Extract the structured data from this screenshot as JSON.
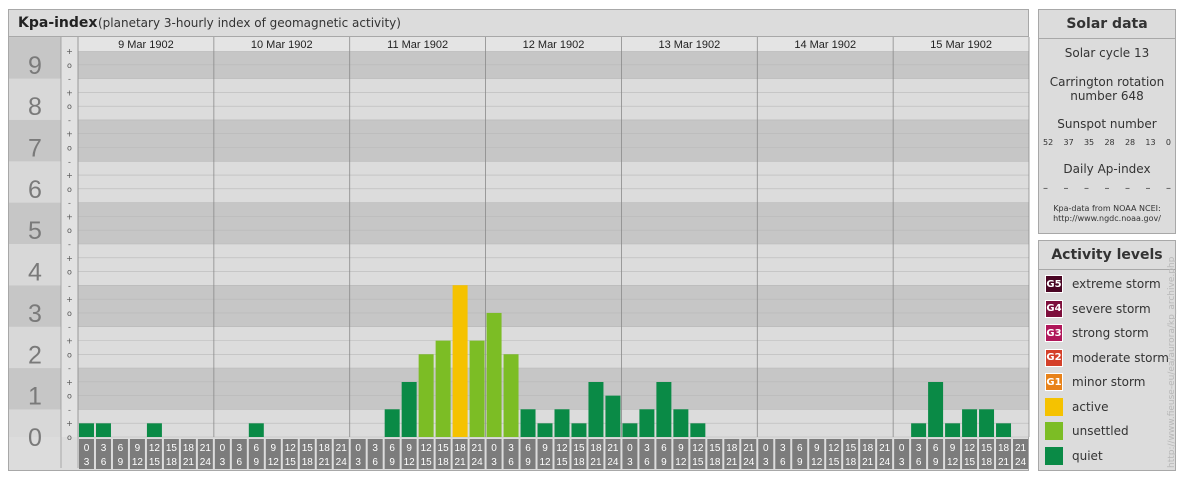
{
  "title": "Kpa-index",
  "subtitle": "(planetary 3-hourly index of geomagnetic activity)",
  "chart_data": {
    "type": "bar",
    "days": [
      "9 Mar 1902",
      "10 Mar 1902",
      "11 Mar 1902",
      "12 Mar 1902",
      "13 Mar 1902",
      "14 Mar 1902",
      "15 Mar 1902"
    ],
    "interval_start_labels": [
      "0",
      "3",
      "6",
      "9",
      "12",
      "15",
      "18",
      "21"
    ],
    "interval_end_labels": [
      "3",
      "6",
      "9",
      "12",
      "15",
      "18",
      "21",
      "24"
    ],
    "y_major_labels": [
      "0",
      "1",
      "2",
      "3",
      "4",
      "5",
      "6",
      "7",
      "8",
      "9"
    ],
    "y_minor_labels": [
      "-",
      "o",
      "+"
    ],
    "ylim": [
      0,
      9.33
    ],
    "values": [
      0.33,
      0.33,
      0,
      0,
      0.33,
      0,
      0,
      0,
      0,
      0,
      0.33,
      0,
      0,
      0,
      0,
      0,
      0,
      0,
      0.67,
      1.33,
      2,
      2.33,
      3.67,
      2.33,
      3,
      2,
      0.67,
      0.33,
      0.67,
      0.33,
      1.33,
      1,
      0.33,
      0.67,
      1.33,
      0.67,
      0.33,
      0,
      0,
      0,
      0,
      0,
      0,
      0,
      0,
      0,
      0,
      0,
      0,
      0.33,
      1.33,
      0.33,
      0.67,
      0.67,
      0.33,
      0
    ],
    "levels": [
      "quiet",
      "quiet",
      "quiet",
      "quiet",
      "quiet",
      "quiet",
      "quiet",
      "quiet",
      "quiet",
      "quiet",
      "quiet",
      "quiet",
      "quiet",
      "quiet",
      "quiet",
      "quiet",
      "quiet",
      "quiet",
      "quiet",
      "quiet",
      "unsettled",
      "unsettled",
      "active",
      "unsettled",
      "unsettled",
      "unsettled",
      "quiet",
      "quiet",
      "quiet",
      "quiet",
      "quiet",
      "quiet",
      "quiet",
      "quiet",
      "quiet",
      "quiet",
      "quiet",
      "quiet",
      "quiet",
      "quiet",
      "quiet",
      "quiet",
      "quiet",
      "quiet",
      "quiet",
      "quiet",
      "quiet",
      "quiet",
      "quiet",
      "quiet",
      "quiet",
      "quiet",
      "quiet",
      "quiet",
      "quiet",
      "quiet"
    ]
  },
  "colors": {
    "quiet": "#0a8a46",
    "unsettled": "#7cbd25",
    "active": "#f5c200",
    "minor_storm": "#e8821a",
    "moderate_storm": "#d4402a",
    "strong_storm": "#b0175a",
    "severe_storm": "#7d0f3c",
    "extreme_storm": "#4a0624"
  },
  "solar": {
    "heading": "Solar data",
    "cycle": "Solar cycle 13",
    "carrington_line1": "Carrington rotation",
    "carrington_line2": "number 648",
    "sunspot_heading": "Sunspot number",
    "sunspot_values": [
      "52",
      "37",
      "35",
      "28",
      "28",
      "13",
      "0"
    ],
    "ap_heading": "Daily Ap-index",
    "ap_values": [
      "–",
      "–",
      "–",
      "–",
      "–",
      "–",
      "–"
    ],
    "source_line1": "Kpa-data from NOAA NCEI:",
    "source_line2": "http://www.ngdc.noaa.gov/"
  },
  "activity": {
    "heading": "Activity levels",
    "items": [
      {
        "badge": "G5",
        "label": "extreme storm",
        "color": "#4a0624"
      },
      {
        "badge": "G4",
        "label": "severe storm",
        "color": "#7d0f3c"
      },
      {
        "badge": "G3",
        "label": "strong storm",
        "color": "#b0175a"
      },
      {
        "badge": "G2",
        "label": "moderate storm",
        "color": "#d4402a"
      },
      {
        "badge": "G1",
        "label": "minor storm",
        "color": "#e8821a"
      },
      {
        "badge": "",
        "label": "active",
        "color": "#f5c200"
      },
      {
        "badge": "",
        "label": "unsettled",
        "color": "#7cbd25"
      },
      {
        "badge": "",
        "label": "quiet",
        "color": "#0a8a46"
      }
    ]
  },
  "watermark": "http://www.fieuse-eu/ea/aurora/kp_archive.php"
}
